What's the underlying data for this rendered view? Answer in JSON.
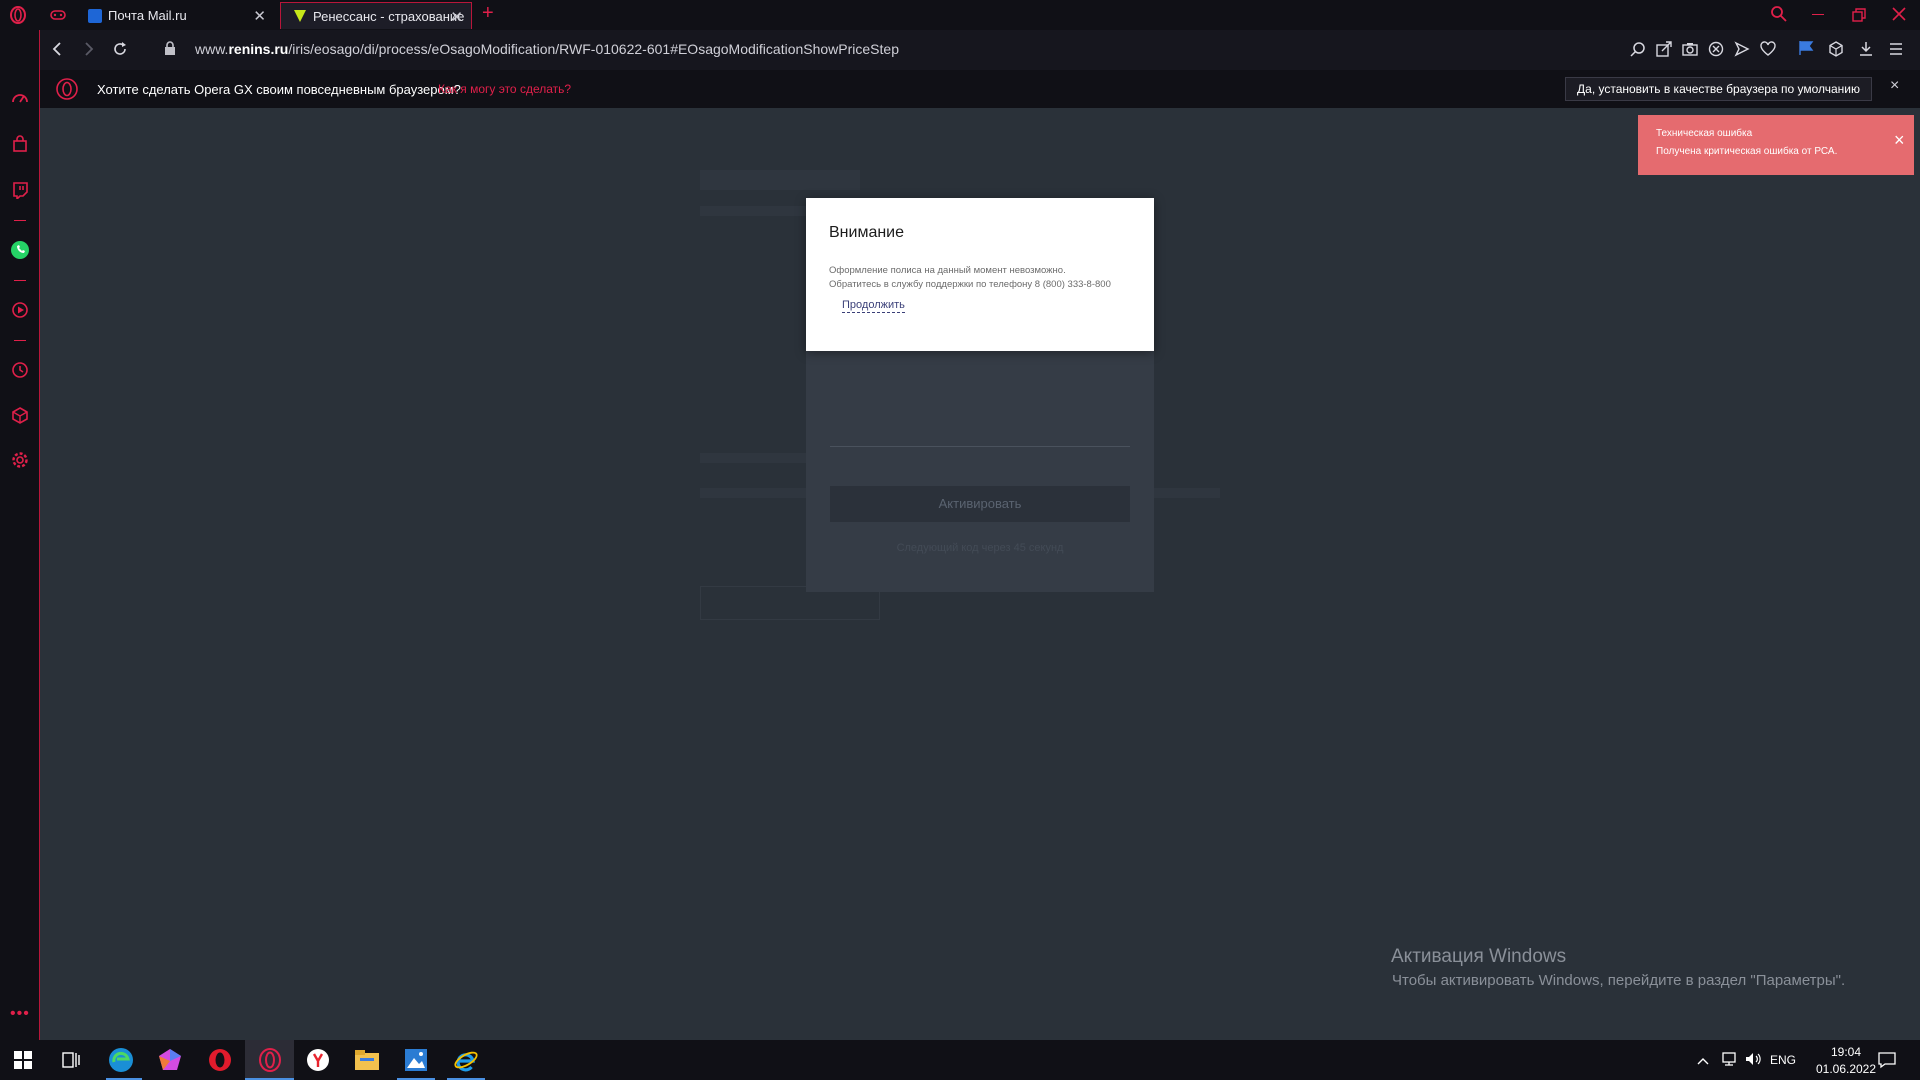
{
  "browser": {
    "tabs": [
      {
        "label": "Почта Mail.ru",
        "favicon_color": "#1e66d6"
      },
      {
        "label": "Ренессанс - страхование",
        "favicon_color": "#c7e81a"
      }
    ],
    "new_tab_label": "+",
    "url": {
      "prefix": "www.",
      "domain": "renins.ru",
      "path": "/iris/eosago/di/process/eOsagoModification/RWF-010622-601#EOsagoModificationShowPriceStep"
    },
    "accent_color": "#e0204a"
  },
  "default_browser_bar": {
    "question": "Хотите сделать Opera GX своим повседневным браузером?",
    "how_link": "Как я могу это сделать?",
    "confirm_button": "Да, установить в качестве браузера по умолчанию",
    "close": "×"
  },
  "page": {
    "form_button": "Активировать",
    "form_link": "Следующий код через 45 секунд"
  },
  "modal": {
    "title": "Внимание",
    "line1": "Оформление полиса на данный момент невозможно.",
    "line2": "Обратитесь в службу поддержки по телефону 8 (800) 333-8-800",
    "continue_link": "Продолжить"
  },
  "toast": {
    "title": "Техническая ошибка",
    "message": "Получена критическая ошибка от РСА.",
    "close": "×",
    "color": "#e56b6f"
  },
  "watermark": {
    "title": "Активация Windows",
    "subtitle": "Чтобы активировать Windows, перейдите в раздел \"Параметры\"."
  },
  "taskbar": {
    "language": "ENG",
    "time": "19:04",
    "date": "01.06.2022"
  }
}
